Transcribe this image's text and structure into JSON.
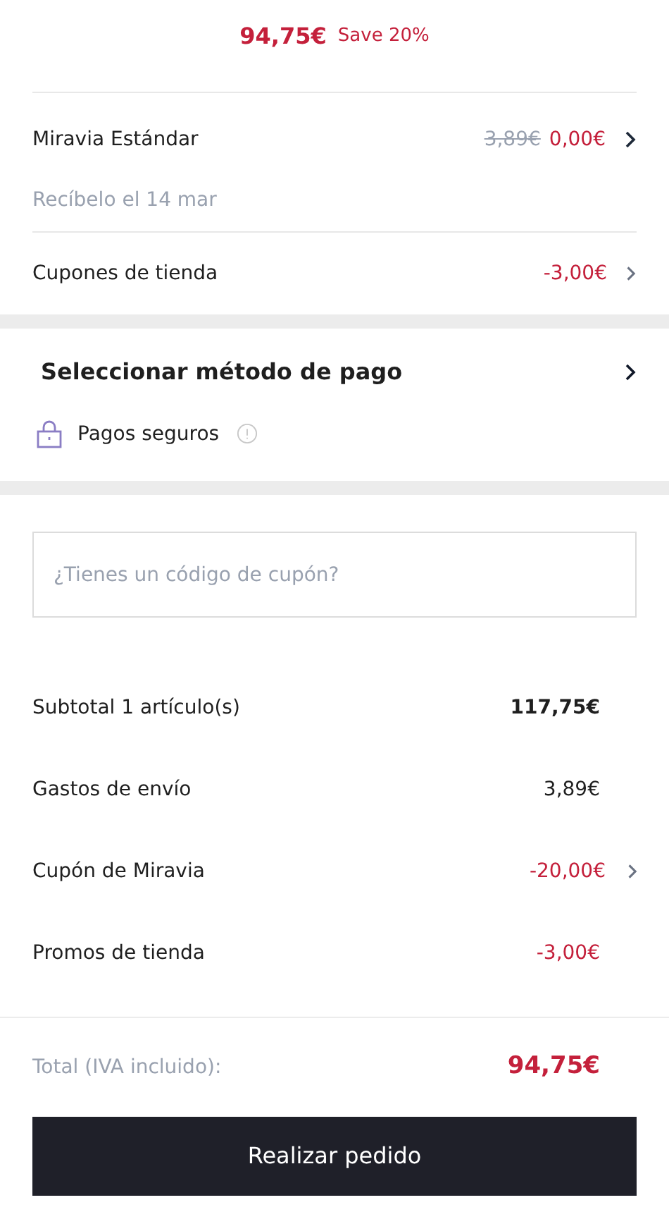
{
  "header": {
    "price": "94,75€",
    "saving": "Save 20%"
  },
  "shipping": {
    "method": "Miravia Estándar",
    "old_price": "3,89€",
    "price": "0,00€",
    "delivery": "Recíbelo el 14 mar"
  },
  "store_coupons": {
    "label": "Cupones de tienda",
    "value": "-3,00€"
  },
  "payment": {
    "title": "Seleccionar método de pago",
    "secure_label": "Pagos seguros"
  },
  "coupon_field": {
    "placeholder": "¿Tienes un código de cupón?"
  },
  "summary": [
    {
      "label": "Subtotal 1 artículo(s)",
      "value": "117,75€",
      "kind": "strong",
      "chevron": false
    },
    {
      "label": "Gastos de envío",
      "value": "3,89€",
      "kind": "normal",
      "chevron": false
    },
    {
      "label": "Cupón de Miravia",
      "value": "-20,00€",
      "kind": "discount",
      "chevron": true
    },
    {
      "label": "Promos de tienda",
      "value": "-3,00€",
      "kind": "discount",
      "chevron": false
    }
  ],
  "total": {
    "label": "Total (IVA incluido):",
    "value": "94,75€"
  },
  "order_button": "Realizar pedido"
}
